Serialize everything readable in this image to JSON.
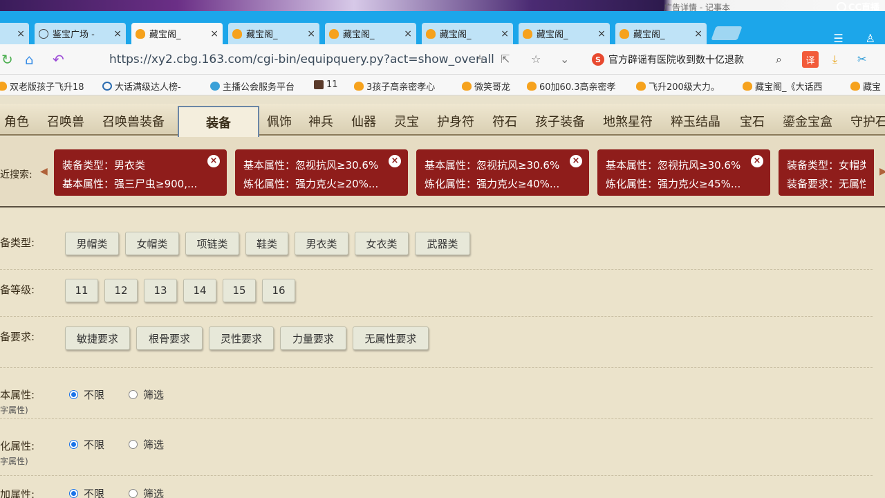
{
  "banner": {
    "notepad_title": "广告详情 - 记事本",
    "cc_label": "CC直播"
  },
  "tabs": [
    {
      "label": "",
      "icon": "close-icon"
    },
    {
      "label": "鉴宝广场 -",
      "icon": "globe-icon"
    },
    {
      "label": "藏宝阁_",
      "icon": "chick-icon"
    },
    {
      "label": "藏宝阁_",
      "icon": "chick-icon"
    },
    {
      "label": "藏宝阁_",
      "icon": "chick-icon"
    },
    {
      "label": "藏宝阁_",
      "icon": "chick-icon"
    },
    {
      "label": "藏宝阁_",
      "icon": "chick-icon"
    },
    {
      "label": "藏宝阁_",
      "icon": "chick-icon"
    }
  ],
  "address": {
    "url": "https://xy2.cbg.163.com/cgi-bin/equipquery.py?act=show_overall",
    "news": "官方辟谣有医院收到数十亿退款",
    "translate": "译"
  },
  "bookmarks": [
    "双老版孩子飞升18",
    "大话满级达人榜-",
    "主播公会服务平台",
    "11",
    "3孩子高亲密孝心",
    "微笑哥龙",
    "60加60.3高亲密孝",
    "飞升200级大力。",
    "藏宝阁_《大话西",
    "藏宝"
  ],
  "categories": [
    "角色",
    "召唤兽",
    "召唤兽装备",
    "装备",
    "佩饰",
    "神兵",
    "仙器",
    "灵宝",
    "护身符",
    "符石",
    "孩子装备",
    "地煞星符",
    "粹玉结晶",
    "宝石",
    "鎏金宝盒",
    "守护石"
  ],
  "recent": {
    "label": "近搜索:",
    "chips": [
      {
        "line1": "装备类型：男衣类",
        "line2": "基本属性：强三尸虫≥900,..."
      },
      {
        "line1": "基本属性：忽视抗风≥30.6%",
        "line2": "炼化属性：强力克火≥20%..."
      },
      {
        "line1": "基本属性：忽视抗风≥30.6%",
        "line2": "炼化属性：强力克火≥40%..."
      },
      {
        "line1": "基本属性：忽视抗风≥30.6%",
        "line2": "炼化属性：强力克火≥45%..."
      },
      {
        "line1": "装备类型：女帽类",
        "line2": "装备要求：无属性"
      }
    ]
  },
  "filters": {
    "type": {
      "label": "备类型:",
      "options": [
        "男帽类",
        "女帽类",
        "项链类",
        "鞋类",
        "男衣类",
        "女衣类",
        "武器类"
      ]
    },
    "level": {
      "label": "备等级:",
      "options": [
        "11",
        "12",
        "13",
        "14",
        "15",
        "16"
      ]
    },
    "req": {
      "label": "备要求:",
      "options": [
        "敏捷要求",
        "根骨要求",
        "灵性要求",
        "力量要求",
        "无属性要求"
      ]
    },
    "base": {
      "label": "本属性:",
      "sub": "字属性)",
      "opt1": "不限",
      "opt2": "筛选"
    },
    "refine": {
      "label": "化属性:",
      "sub": "字属性)",
      "opt1": "不限",
      "opt2": "筛选"
    },
    "extra": {
      "label": "加属性:",
      "opt1": "不限",
      "opt2": "筛选"
    }
  }
}
